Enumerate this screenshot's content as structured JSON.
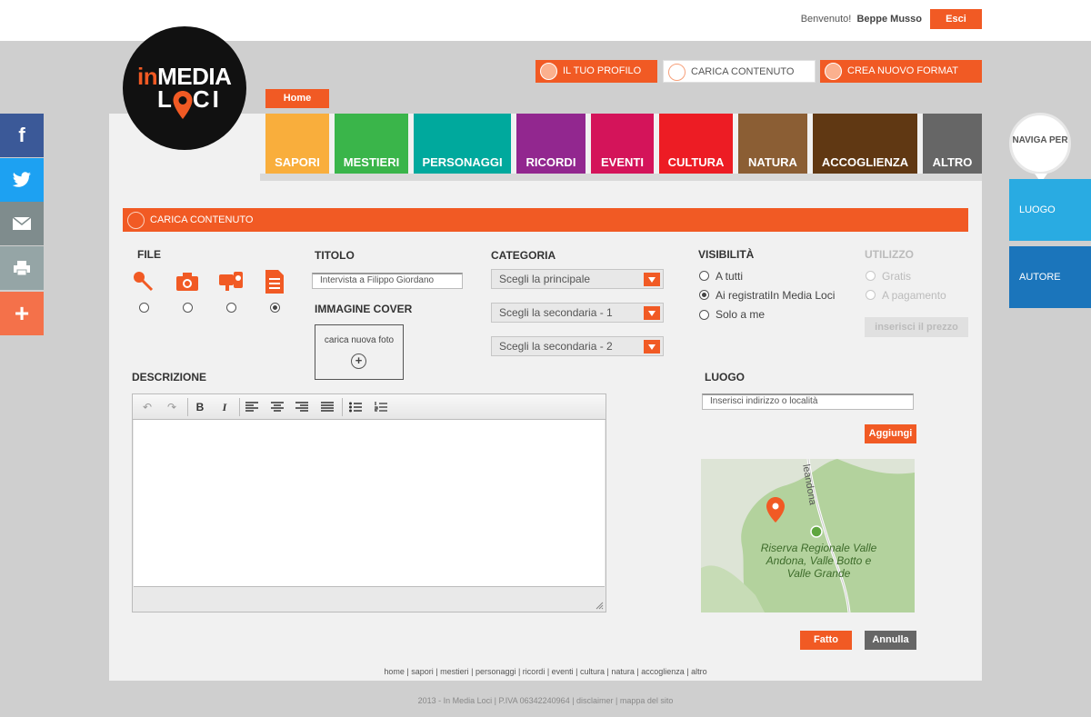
{
  "header": {
    "welcome": "Benvenuto!",
    "user": "Beppe Musso",
    "logout": "Esci"
  },
  "logo": {
    "part1": "in",
    "part2": "MEDIA",
    "part3": "L",
    "part4": "CI"
  },
  "topnav": {
    "profile": "IL TUO PROFILO",
    "upload": "CARICA CONTENUTO",
    "new_format": "CREA NUOVO FORMAT"
  },
  "home_tab": "Home",
  "categories": [
    {
      "label": "SAPORI",
      "color": "#f9ae3c"
    },
    {
      "label": "MESTIERI",
      "color": "#3ab54a"
    },
    {
      "label": "PERSONAGGI",
      "color": "#00a99d"
    },
    {
      "label": "RICORDI",
      "color": "#92278f"
    },
    {
      "label": "EVENTI",
      "color": "#d4145a"
    },
    {
      "label": "CULTURA",
      "color": "#ed1c24"
    },
    {
      "label": "NATURA",
      "color": "#8b5e34"
    },
    {
      "label": "ACCOGLIENZA",
      "color": "#603813"
    },
    {
      "label": "ALTRO",
      "color": "#666666"
    }
  ],
  "social": [
    "facebook-icon",
    "twitter-icon",
    "email-icon",
    "print-icon",
    "share-plus-icon"
  ],
  "naviga": {
    "title": "NAVIGA PER",
    "luogo": "LUOGO",
    "autore": "AUTORE"
  },
  "section_title": "CARICA CONTENUTO",
  "file": {
    "label": "FILE",
    "types": [
      "audio-icon",
      "photo-icon",
      "video-icon",
      "document-icon"
    ],
    "selected": 3
  },
  "titolo": {
    "label": "TITOLO",
    "value": "Intervista a Filippo Giordano"
  },
  "cover": {
    "label": "IMMAGINE COVER",
    "upload": "carica nuova foto"
  },
  "categoria": {
    "label": "CATEGORIA",
    "main": "Scegli la principale",
    "sec1": "Scegli la secondaria - 1",
    "sec2": "Scegli la secondaria - 2"
  },
  "visibilita": {
    "label": "VISIBILITÀ",
    "options": [
      "A tutti",
      "Ai registratiIn Media Loci",
      "Solo a me"
    ],
    "selected": 1
  },
  "utilizzo": {
    "label": "UTILIZZO",
    "options": [
      "Gratis",
      "A pagamento"
    ],
    "price_button": "inserisci il prezzo"
  },
  "descrizione": {
    "label": "DESCRIZIONE"
  },
  "luogo": {
    "label": "LUOGO",
    "placeholder": "Inserisci indirizzo o località",
    "add": "Aggiungi",
    "map_road": "leandona",
    "map_place": "Riserva Regionale Valle Andona, Valle Botto e Valle Grande"
  },
  "actions": {
    "done": "Fatto",
    "cancel": "Annulla"
  },
  "footer": {
    "links": "home | sapori | mestieri | personaggi | ricordi | eventi | cultura | natura | accoglienza | altro",
    "copyright": "2013 - In Media Loci | P.IVA 06342240964 | disclaimer | mappa del sito"
  }
}
